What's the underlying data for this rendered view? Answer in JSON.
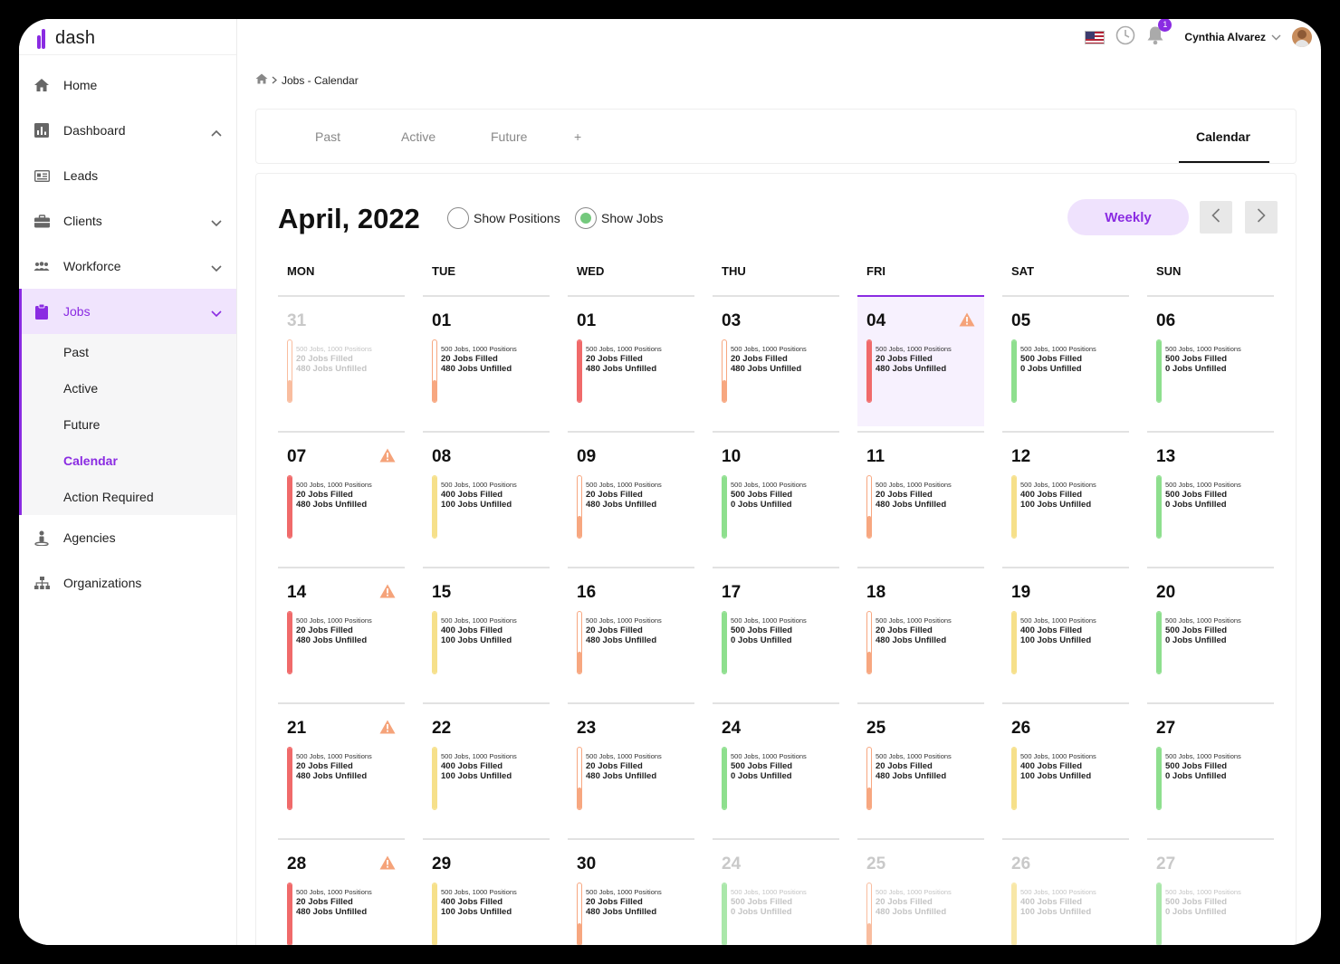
{
  "app": {
    "logo_text": "dash"
  },
  "sidebar": {
    "items": [
      {
        "label": "Home",
        "icon": "home-icon",
        "chevron": ""
      },
      {
        "label": "Dashboard",
        "icon": "bar-chart-icon",
        "chevron": "up"
      },
      {
        "label": "Leads",
        "icon": "id-card-icon",
        "chevron": ""
      },
      {
        "label": "Clients",
        "icon": "briefcase-icon",
        "chevron": "down"
      },
      {
        "label": "Workforce",
        "icon": "people-icon",
        "chevron": "down"
      }
    ],
    "jobs": {
      "label": "Jobs",
      "subitems": [
        "Past",
        "Active",
        "Future",
        "Calendar",
        "Action Required"
      ],
      "active_sub": "Calendar"
    },
    "bottom_items": [
      {
        "label": "Agencies",
        "icon": "agency-person-icon"
      },
      {
        "label": "Organizations",
        "icon": "org-chart-icon"
      }
    ]
  },
  "topbar": {
    "notification_count": "1",
    "user_name": "Cynthia Alvarez"
  },
  "breadcrumb": {
    "current": "Jobs - Calendar"
  },
  "tabs": {
    "items": [
      "Past",
      "Active",
      "Future",
      "+"
    ],
    "active": "Calendar"
  },
  "calendar": {
    "month_title": "April, 2022",
    "show_positions_label": "Show Positions",
    "show_jobs_label": "Show Jobs",
    "selected_toggle": "Show Jobs",
    "view_label": "Weekly",
    "weekdays": [
      "MON",
      "TUE",
      "WED",
      "THU",
      "FRI",
      "SAT",
      "SUN"
    ],
    "colors": {
      "red": "#f06a6a",
      "orange": "#f7a780",
      "yellow": "#f6e08a",
      "green": "#8edf8e",
      "accent": "#8a2be2"
    },
    "days": [
      {
        "num": "31",
        "pos": "500 Jobs, 1000 Positions",
        "filled": "20 Jobs Filled",
        "unfilled": "480 Jobs Unfilled",
        "color": "orange",
        "fill": 0.35,
        "dim": true,
        "warn": false
      },
      {
        "num": "01",
        "pos": "500 Jobs, 1000 Positions",
        "filled": "20 Jobs Filled",
        "unfilled": "480 Jobs Unfilled",
        "color": "orange",
        "fill": 0.35,
        "dim": false,
        "warn": false
      },
      {
        "num": "01",
        "pos": "500 Jobs, 1000 Positions",
        "filled": "20 Jobs Filled",
        "unfilled": "480 Jobs Unfilled",
        "color": "red",
        "fill": 1,
        "dim": false,
        "warn": false
      },
      {
        "num": "03",
        "pos": "500 Jobs, 1000 Positions",
        "filled": "20 Jobs Filled",
        "unfilled": "480 Jobs Unfilled",
        "color": "orange",
        "fill": 0.35,
        "dim": false,
        "warn": false
      },
      {
        "num": "04",
        "pos": "500 Jobs, 1000 Positions",
        "filled": "20 Jobs Filled",
        "unfilled": "480 Jobs Unfilled",
        "color": "red",
        "fill": 1,
        "dim": false,
        "warn": true,
        "today": true
      },
      {
        "num": "05",
        "pos": "500 Jobs, 1000 Positions",
        "filled": "500 Jobs Filled",
        "unfilled": "0 Jobs Unfilled",
        "color": "green",
        "fill": 1,
        "dim": false,
        "warn": false
      },
      {
        "num": "06",
        "pos": "500 Jobs, 1000 Positions",
        "filled": "500 Jobs Filled",
        "unfilled": "0 Jobs Unfilled",
        "color": "green",
        "fill": 1,
        "dim": false,
        "warn": false
      },
      {
        "num": "07",
        "pos": "500 Jobs, 1000 Positions",
        "filled": "20 Jobs Filled",
        "unfilled": "480 Jobs Unfilled",
        "color": "red",
        "fill": 1,
        "dim": false,
        "warn": true
      },
      {
        "num": "08",
        "pos": "500 Jobs, 1000 Positions",
        "filled": "400 Jobs Filled",
        "unfilled": "100 Jobs Unfilled",
        "color": "yellow",
        "fill": 1,
        "dim": false,
        "warn": false
      },
      {
        "num": "09",
        "pos": "500 Jobs, 1000 Positions",
        "filled": "20 Jobs Filled",
        "unfilled": "480 Jobs Unfilled",
        "color": "orange",
        "fill": 0.35,
        "dim": false,
        "warn": false
      },
      {
        "num": "10",
        "pos": "500 Jobs, 1000 Positions",
        "filled": "500 Jobs Filled",
        "unfilled": "0 Jobs Unfilled",
        "color": "green",
        "fill": 1,
        "dim": false,
        "warn": false
      },
      {
        "num": "11",
        "pos": "500 Jobs, 1000 Positions",
        "filled": "20 Jobs Filled",
        "unfilled": "480 Jobs Unfilled",
        "color": "orange",
        "fill": 0.35,
        "dim": false,
        "warn": false
      },
      {
        "num": "12",
        "pos": "500 Jobs, 1000 Positions",
        "filled": "400 Jobs Filled",
        "unfilled": "100 Jobs Unfilled",
        "color": "yellow",
        "fill": 1,
        "dim": false,
        "warn": false
      },
      {
        "num": "13",
        "pos": "500 Jobs, 1000 Positions",
        "filled": "500 Jobs Filled",
        "unfilled": "0 Jobs Unfilled",
        "color": "green",
        "fill": 1,
        "dim": false,
        "warn": false
      },
      {
        "num": "14",
        "pos": "500 Jobs, 1000 Positions",
        "filled": "20 Jobs Filled",
        "unfilled": "480 Jobs Unfilled",
        "color": "red",
        "fill": 1,
        "dim": false,
        "warn": true
      },
      {
        "num": "15",
        "pos": "500 Jobs, 1000 Positions",
        "filled": "400 Jobs Filled",
        "unfilled": "100 Jobs Unfilled",
        "color": "yellow",
        "fill": 1,
        "dim": false,
        "warn": false
      },
      {
        "num": "16",
        "pos": "500 Jobs, 1000 Positions",
        "filled": "20 Jobs Filled",
        "unfilled": "480 Jobs Unfilled",
        "color": "orange",
        "fill": 0.35,
        "dim": false,
        "warn": false
      },
      {
        "num": "17",
        "pos": "500 Jobs, 1000 Positions",
        "filled": "500 Jobs Filled",
        "unfilled": "0 Jobs Unfilled",
        "color": "green",
        "fill": 1,
        "dim": false,
        "warn": false
      },
      {
        "num": "18",
        "pos": "500 Jobs, 1000 Positions",
        "filled": "20 Jobs Filled",
        "unfilled": "480 Jobs Unfilled",
        "color": "orange",
        "fill": 0.35,
        "dim": false,
        "warn": false
      },
      {
        "num": "19",
        "pos": "500 Jobs, 1000 Positions",
        "filled": "400 Jobs Filled",
        "unfilled": "100 Jobs Unfilled",
        "color": "yellow",
        "fill": 1,
        "dim": false,
        "warn": false
      },
      {
        "num": "20",
        "pos": "500 Jobs, 1000 Positions",
        "filled": "500 Jobs Filled",
        "unfilled": "0 Jobs Unfilled",
        "color": "green",
        "fill": 1,
        "dim": false,
        "warn": false
      },
      {
        "num": "21",
        "pos": "500 Jobs, 1000 Positions",
        "filled": "20 Jobs Filled",
        "unfilled": "480 Jobs Unfilled",
        "color": "red",
        "fill": 1,
        "dim": false,
        "warn": true
      },
      {
        "num": "22",
        "pos": "500 Jobs, 1000 Positions",
        "filled": "400 Jobs Filled",
        "unfilled": "100 Jobs Unfilled",
        "color": "yellow",
        "fill": 1,
        "dim": false,
        "warn": false
      },
      {
        "num": "23",
        "pos": "500 Jobs, 1000 Positions",
        "filled": "20 Jobs Filled",
        "unfilled": "480 Jobs Unfilled",
        "color": "orange",
        "fill": 0.35,
        "dim": false,
        "warn": false
      },
      {
        "num": "24",
        "pos": "500 Jobs, 1000 Positions",
        "filled": "500 Jobs Filled",
        "unfilled": "0 Jobs Unfilled",
        "color": "green",
        "fill": 1,
        "dim": false,
        "warn": false
      },
      {
        "num": "25",
        "pos": "500 Jobs, 1000 Positions",
        "filled": "20 Jobs Filled",
        "unfilled": "480 Jobs Unfilled",
        "color": "orange",
        "fill": 0.35,
        "dim": false,
        "warn": false
      },
      {
        "num": "26",
        "pos": "500 Jobs, 1000 Positions",
        "filled": "400 Jobs Filled",
        "unfilled": "100 Jobs Unfilled",
        "color": "yellow",
        "fill": 1,
        "dim": false,
        "warn": false
      },
      {
        "num": "27",
        "pos": "500 Jobs, 1000 Positions",
        "filled": "500 Jobs Filled",
        "unfilled": "0 Jobs Unfilled",
        "color": "green",
        "fill": 1,
        "dim": false,
        "warn": false
      },
      {
        "num": "28",
        "pos": "500 Jobs, 1000 Positions",
        "filled": "20 Jobs Filled",
        "unfilled": "480 Jobs Unfilled",
        "color": "red",
        "fill": 1,
        "dim": false,
        "warn": true
      },
      {
        "num": "29",
        "pos": "500 Jobs, 1000 Positions",
        "filled": "400 Jobs Filled",
        "unfilled": "100 Jobs Unfilled",
        "color": "yellow",
        "fill": 1,
        "dim": false,
        "warn": false
      },
      {
        "num": "30",
        "pos": "500 Jobs, 1000 Positions",
        "filled": "20 Jobs Filled",
        "unfilled": "480 Jobs Unfilled",
        "color": "orange",
        "fill": 0.35,
        "dim": false,
        "warn": false
      },
      {
        "num": "24",
        "pos": "500 Jobs, 1000 Positions",
        "filled": "500 Jobs Filled",
        "unfilled": "0 Jobs Unfilled",
        "color": "green",
        "fill": 1,
        "dim": true,
        "warn": false
      },
      {
        "num": "25",
        "pos": "500 Jobs, 1000 Positions",
        "filled": "20 Jobs Filled",
        "unfilled": "480 Jobs Unfilled",
        "color": "orange",
        "fill": 0.35,
        "dim": true,
        "warn": false
      },
      {
        "num": "26",
        "pos": "500 Jobs, 1000 Positions",
        "filled": "400 Jobs Filled",
        "unfilled": "100 Jobs Unfilled",
        "color": "yellow",
        "fill": 1,
        "dim": true,
        "warn": false
      },
      {
        "num": "27",
        "pos": "500 Jobs, 1000 Positions",
        "filled": "500 Jobs Filled",
        "unfilled": "0 Jobs Unfilled",
        "color": "green",
        "fill": 1,
        "dim": true,
        "warn": false
      }
    ]
  }
}
